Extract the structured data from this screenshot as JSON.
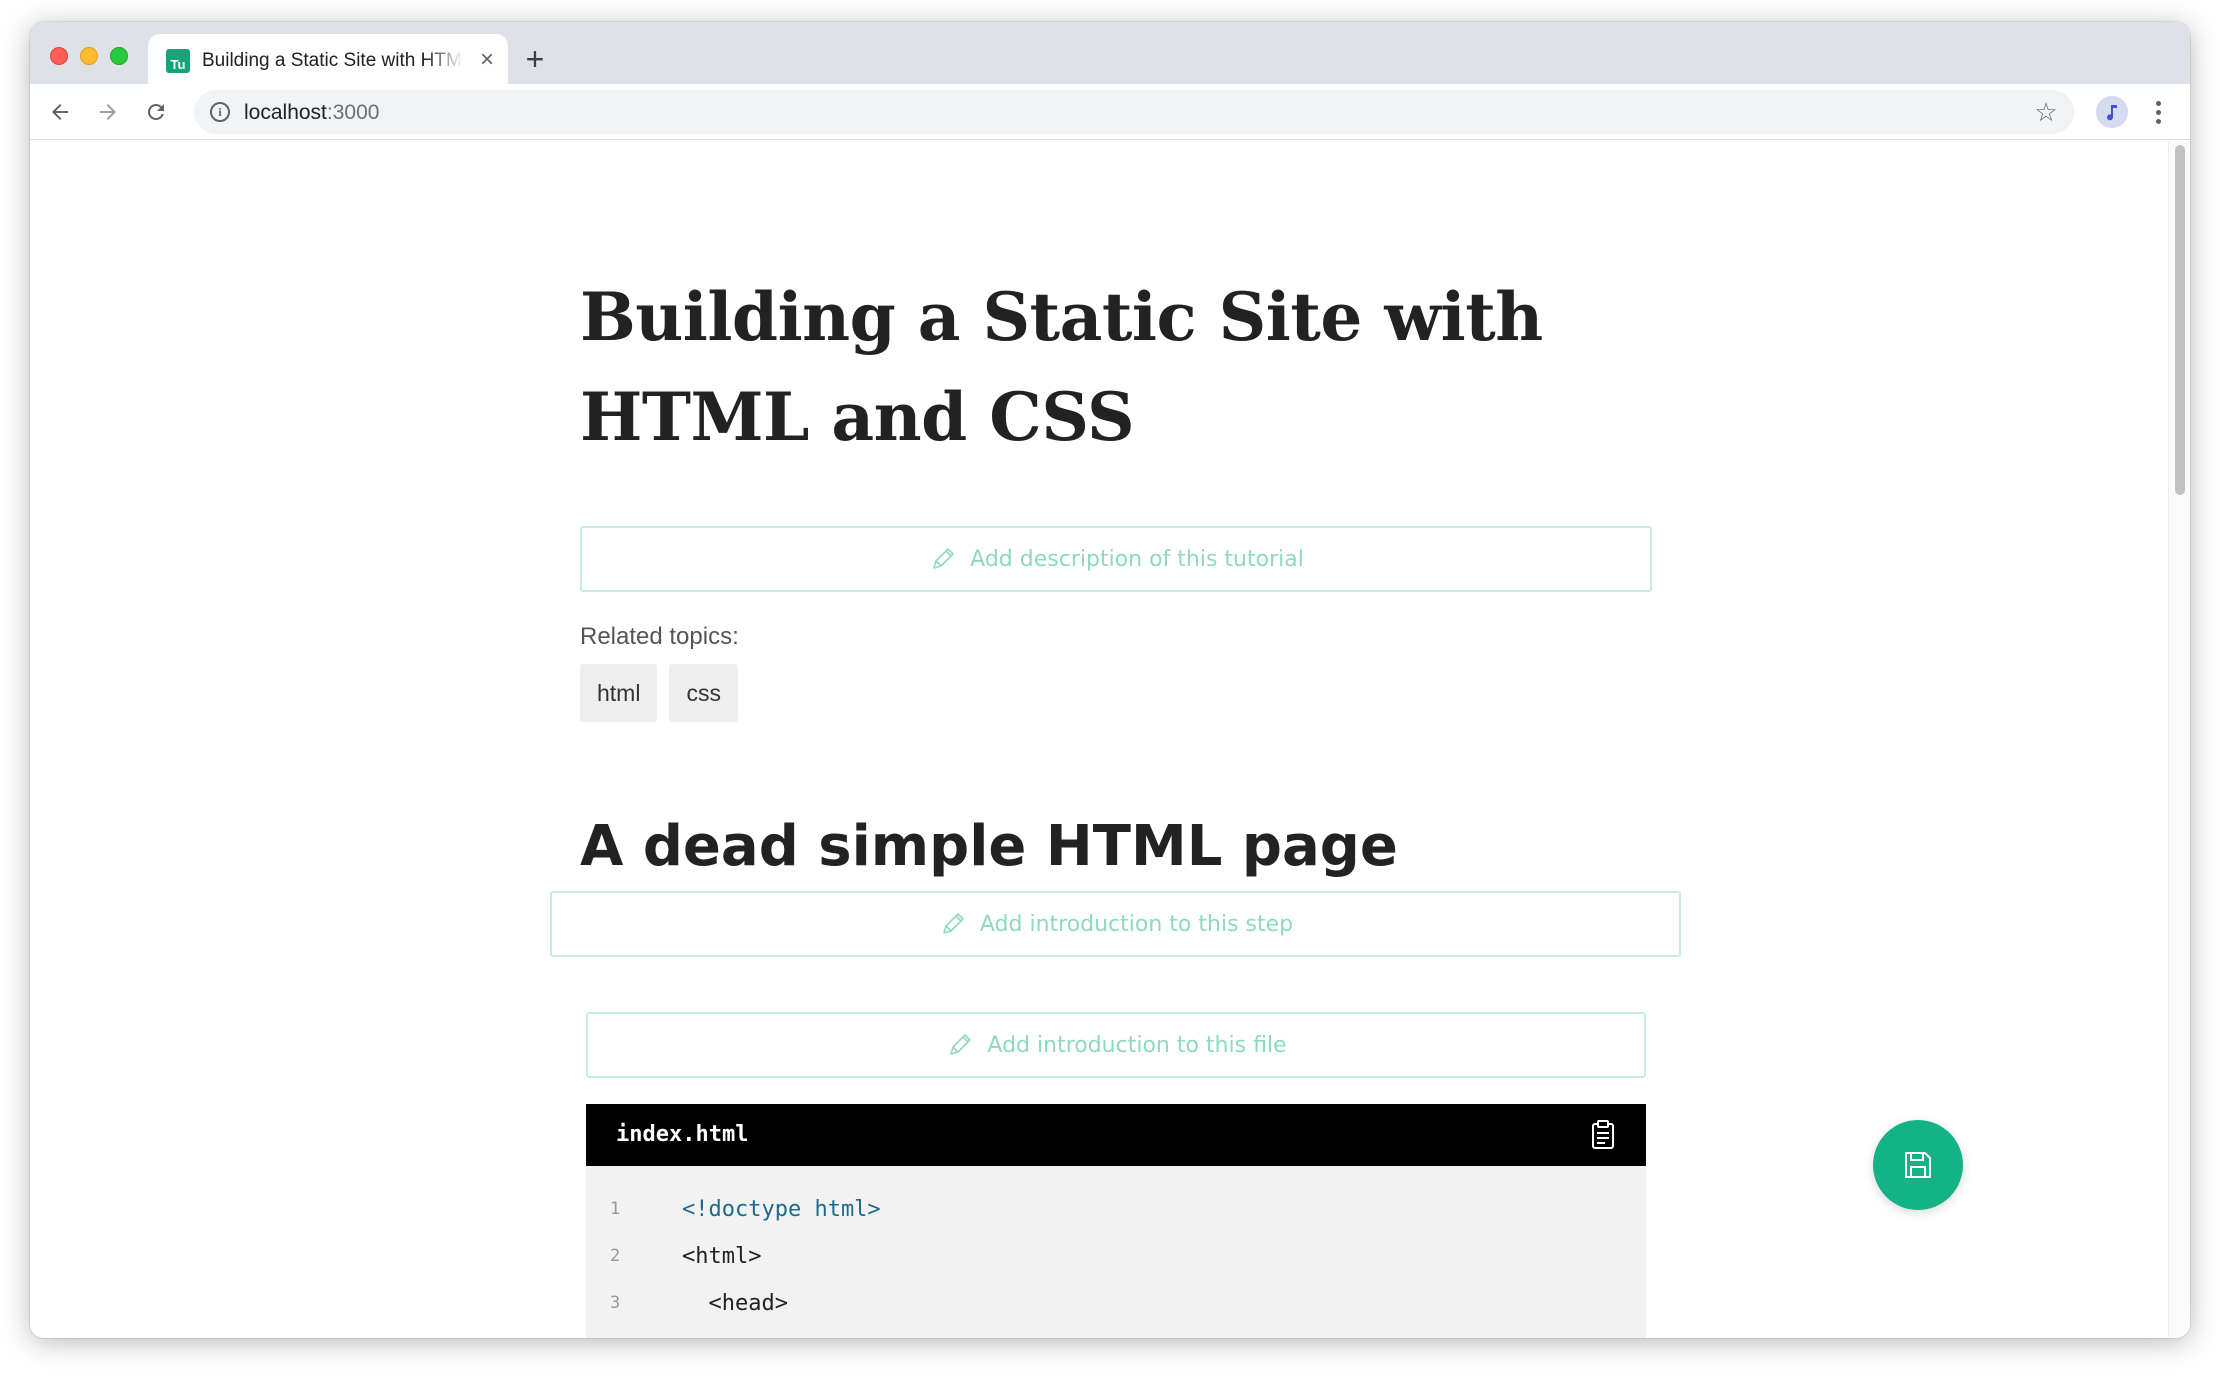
{
  "browser": {
    "tab_title": "Building a Static Site with HTML and CSS",
    "favicon_text": "Tu",
    "tab_close": "×",
    "new_tab": "+",
    "url_host": "localhost",
    "url_port": ":3000"
  },
  "page": {
    "title": "Building a Static Site with HTML and CSS",
    "description_placeholder": "Add description of this tutorial",
    "related_label": "Related topics:",
    "topics": [
      "html",
      "css"
    ],
    "step_heading": "A dead simple HTML page",
    "step_intro_placeholder": "Add introduction to this step",
    "file_intro_placeholder": "Add introduction to this file"
  },
  "code_file": {
    "filename": "index.html",
    "lines": [
      {
        "num": "1",
        "text": "<!doctype html>"
      },
      {
        "num": "2",
        "text": "<html>"
      },
      {
        "num": "3",
        "text": "  <head>"
      }
    ]
  },
  "colors": {
    "accent": "#14b386",
    "placeholder": "#8fd8c1",
    "box_border": "#c7ece0",
    "code_header_bg": "#000000",
    "code_bg": "#f2f2f2",
    "doctype": "#1f6a8c"
  },
  "icons": {
    "edit": "pencil-icon",
    "clipboard": "clipboard-icon",
    "save": "floppy-disk-icon"
  }
}
